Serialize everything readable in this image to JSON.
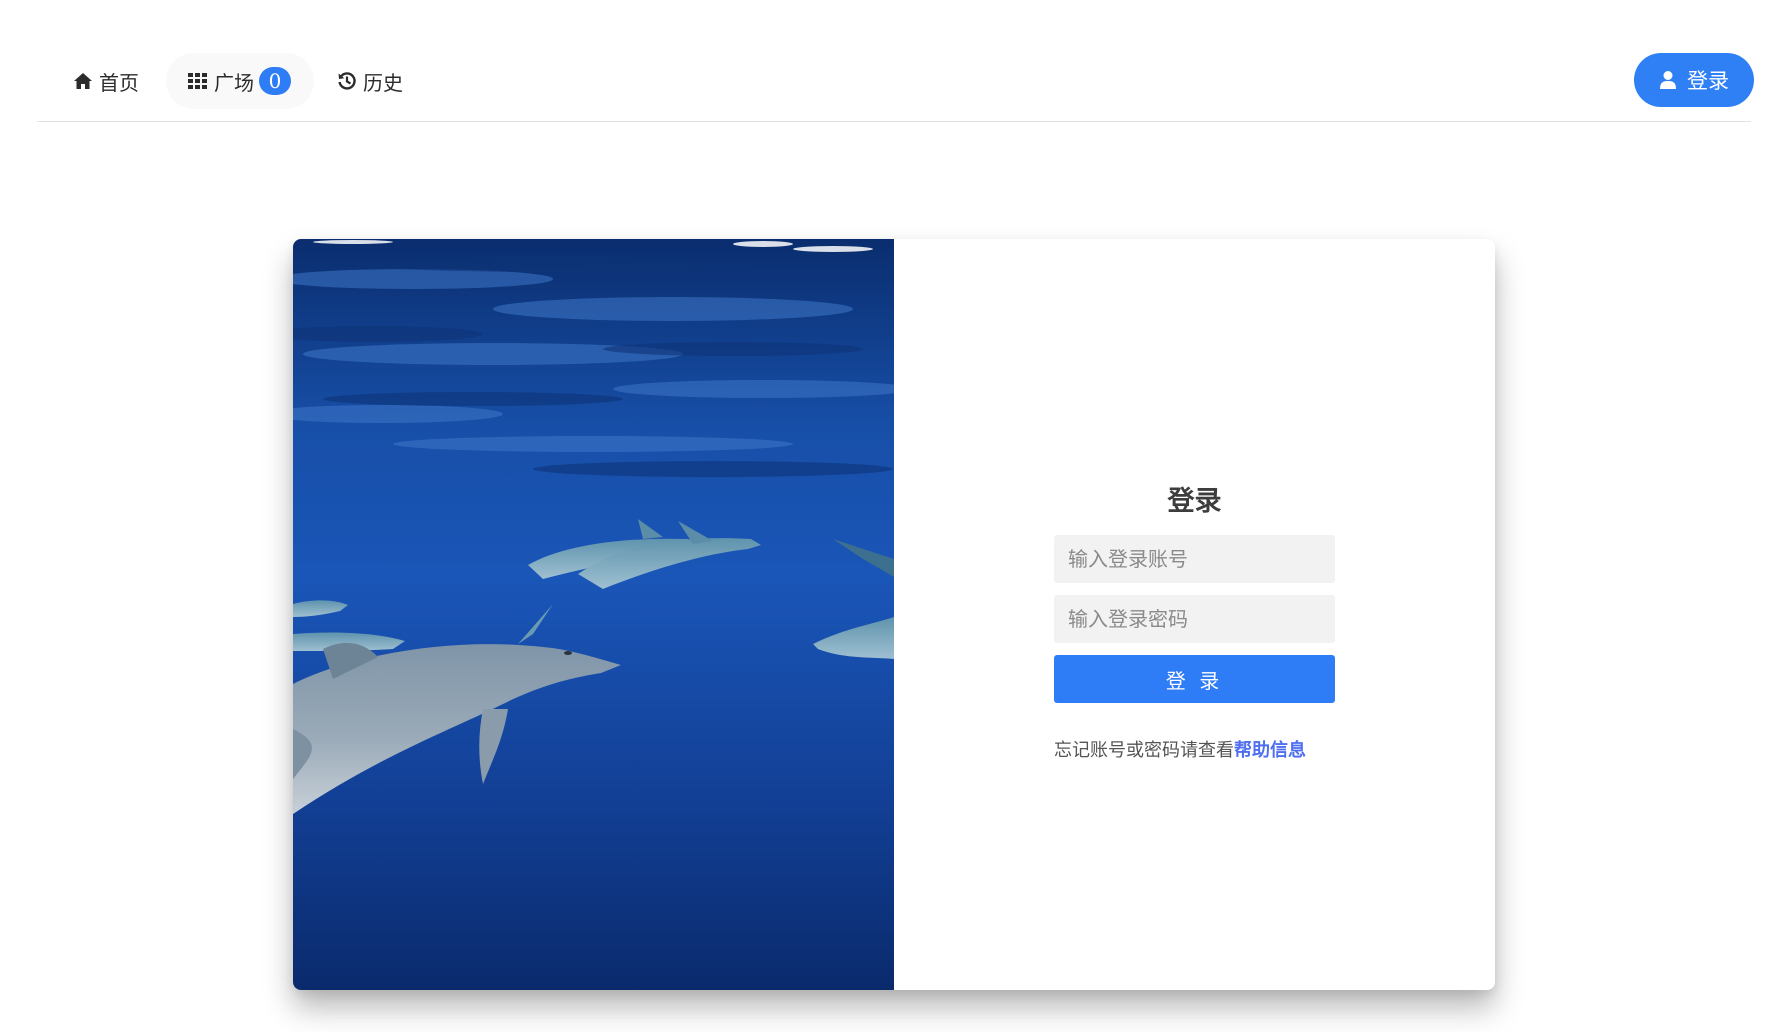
{
  "nav": {
    "home_label": "首页",
    "plaza_label": "广场",
    "plaza_count": "0",
    "history_label": "历史",
    "login_label": "登录"
  },
  "login_form": {
    "title": "登录",
    "account_placeholder": "输入登录账号",
    "password_placeholder": "输入登录密码",
    "submit_label": "登 录",
    "help_prefix": "忘记账号或密码请查看",
    "help_link": "帮助信息"
  },
  "icons": {
    "home": "home-icon",
    "plaza": "grid-icon",
    "history": "history-icon",
    "user": "user-icon"
  },
  "colors": {
    "accent": "#2f7df6",
    "link": "#4f6ff0",
    "ocean_deep": "#0b3a8c",
    "ocean_light": "#1c5fc4"
  }
}
